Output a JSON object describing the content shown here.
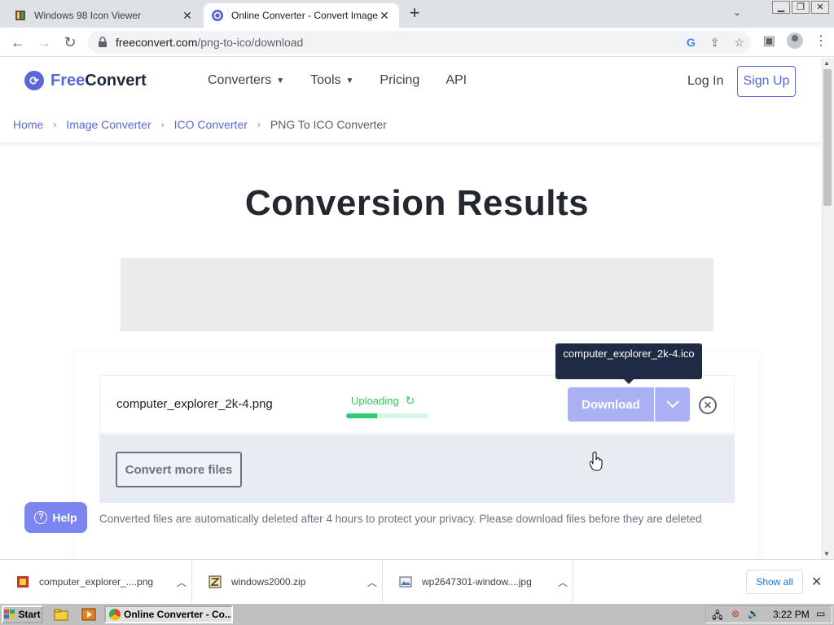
{
  "browser": {
    "tabs": [
      {
        "title": "Windows 98 Icon Viewer",
        "active": false
      },
      {
        "title": "Online Converter - Convert Image, V",
        "active": true
      }
    ],
    "url_host": "freeconvert.com",
    "url_path": "/png-to-ico/download"
  },
  "site": {
    "logo_free": "Free",
    "logo_convert": "Convert",
    "nav": [
      {
        "label": "Converters",
        "has_dropdown": true
      },
      {
        "label": "Tools",
        "has_dropdown": true
      },
      {
        "label": "Pricing",
        "has_dropdown": false
      },
      {
        "label": "API",
        "has_dropdown": false
      }
    ],
    "login": "Log In",
    "signup": "Sign Up",
    "accent": "#5a67d8"
  },
  "breadcrumb": [
    "Home",
    "Image Converter",
    "ICO Converter",
    "PNG To ICO Converter"
  ],
  "heading": "Conversion Results",
  "file": {
    "name": "computer_explorer_2k-4.png",
    "status": "Uploading",
    "progress": 0.38,
    "download_label": "Download",
    "tooltip": "computer_explorer_2k-4.ico"
  },
  "convert_more": "Convert more files",
  "help": "Help",
  "notice": "Converted files are automatically deleted after 4 hours to protect your privacy. Please download files before they are deleted",
  "downloads": {
    "items": [
      {
        "name": "computer_explorer_....png",
        "icon": "png-file-icon"
      },
      {
        "name": "windows2000.zip",
        "icon": "zip-file-icon"
      },
      {
        "name": "wp2647301-window....jpg",
        "icon": "jpg-file-icon"
      }
    ],
    "show_all": "Show all"
  },
  "taskbar": {
    "start": "Start",
    "task": "Online Converter - Co...",
    "clock": "3:22 PM"
  }
}
